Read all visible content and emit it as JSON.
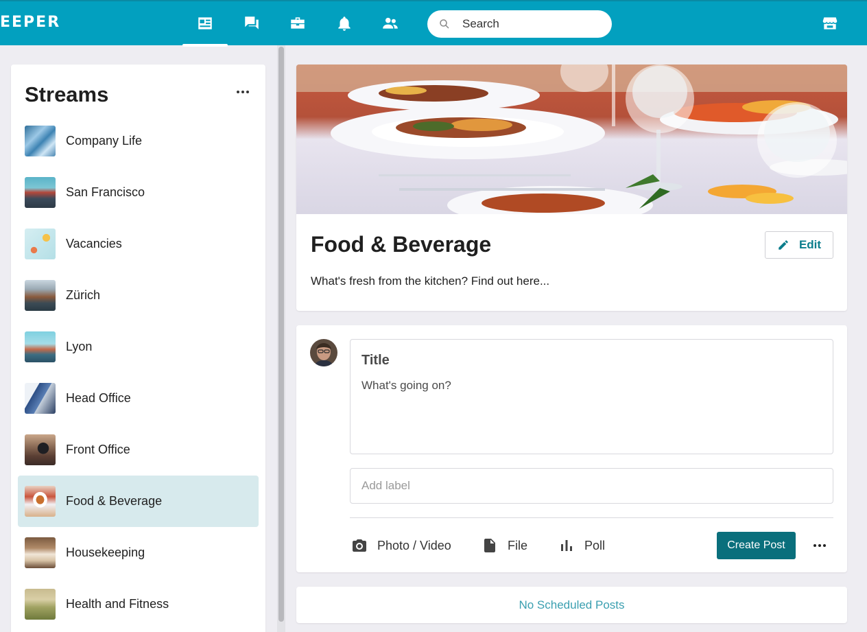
{
  "app": {
    "brand": "EEPER"
  },
  "nav": {
    "icons": [
      "newsfeed-icon",
      "chat-icon",
      "toolbox-icon",
      "bell-icon",
      "people-icon"
    ],
    "active": "newsfeed-icon",
    "store_icon": "store-icon"
  },
  "search": {
    "placeholder": "Search"
  },
  "sidebar": {
    "title": "Streams",
    "items": [
      {
        "label": "Company Life"
      },
      {
        "label": "San Francisco"
      },
      {
        "label": "Vacancies"
      },
      {
        "label": "Zürich"
      },
      {
        "label": "Lyon"
      },
      {
        "label": "Head Office"
      },
      {
        "label": "Front Office"
      },
      {
        "label": "Food & Beverage",
        "active": true
      },
      {
        "label": "Housekeeping"
      },
      {
        "label": "Health and Fitness"
      }
    ]
  },
  "stream": {
    "title": "Food & Beverage",
    "description": "What's fresh from the kitchen? Find out here...",
    "edit_label": "Edit"
  },
  "composer": {
    "title_placeholder": "Title",
    "body_placeholder": "What's going on?",
    "label_placeholder": "Add label",
    "actions": {
      "photo": "Photo / Video",
      "file": "File",
      "poll": "Poll"
    },
    "create_label": "Create Post"
  },
  "scheduled": {
    "label": "No Scheduled Posts"
  },
  "colors": {
    "topbar": "#02a0bf",
    "accent": "#0a6f7c",
    "active_stream_bg": "#d7eaed",
    "scheduled_link": "#3a9fb0"
  }
}
